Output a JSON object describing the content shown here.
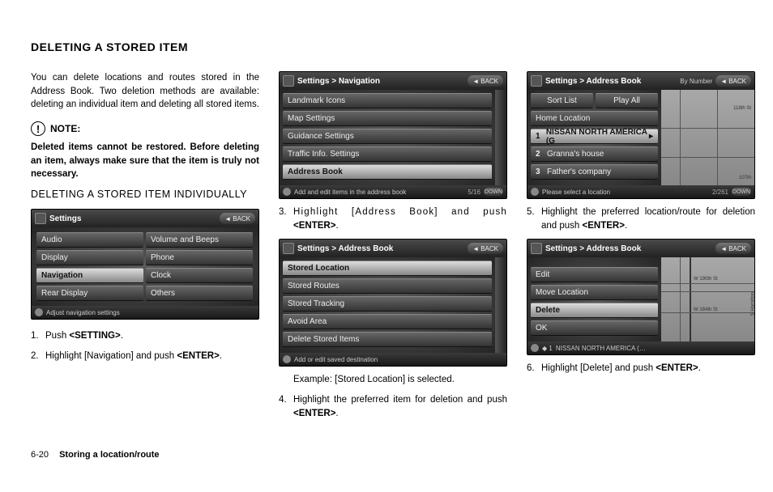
{
  "page": {
    "title": "DELETING A STORED ITEM",
    "intro": "You can delete locations and routes stored in the Address Book. Two deletion methods are available: deleting an individual item and deleting all stored items.",
    "note_label": "NOTE:",
    "note_text": "Deleted items cannot be restored. Before deleting an item, always make sure that the item is truly not necessary.",
    "subhead": "DELETING A STORED ITEM INDIVIDUALLY",
    "footer_page": "6-20",
    "footer_section": "Storing a location/route"
  },
  "steps": {
    "s1": "Push <SETTING>.",
    "s2": "Highlight [Navigation] and push <ENTER>.",
    "s3": "Highlight [Address Book] and push <ENTER>.",
    "s3_ex": "Example: [Stored Location] is selected.",
    "s4": "Highlight the preferred item for deletion and push <ENTER>.",
    "s5": "Highlight the preferred location/route for deletion and push <ENTER>.",
    "s6": "Highlight [Delete] and push <ENTER>."
  },
  "ui": {
    "back": "BACK",
    "scr1": {
      "title": "Settings",
      "foot": "Adjust navigation settings",
      "items_l": [
        "Audio",
        "Display",
        "Navigation",
        "Rear Display"
      ],
      "items_r": [
        "Volume and Beeps",
        "Phone",
        "Clock",
        "Others"
      ],
      "sel": 2
    },
    "scr2": {
      "title": "Settings > Navigation",
      "foot": "Add and edit items in the address book",
      "items": [
        "Landmark Icons",
        "Map Settings",
        "Guidance Settings",
        "Traffic Info. Settings",
        "Address Book"
      ],
      "sel": 4,
      "scroll_text": "5/16",
      "scroll_btn": "DOWN"
    },
    "scr3": {
      "title": "Settings > Address Book",
      "foot": "Add or edit saved destination",
      "items": [
        "Stored Location",
        "Stored Routes",
        "Stored Tracking",
        "Avoid Area",
        "Delete Stored Items"
      ],
      "sel": 0
    },
    "scr4": {
      "title": "Settings > Address Book",
      "foot": "Please select a location",
      "top_right": "By Number",
      "btn_sort": "Sort List",
      "btn_play": "Play All",
      "items": [
        {
          "n": "",
          "t": "Home Location"
        },
        {
          "n": "1",
          "t": "NISSAN NORTH AMERICA (G"
        },
        {
          "n": "2",
          "t": "Granna's house"
        },
        {
          "n": "3",
          "t": "Father's company"
        }
      ],
      "sel": 1,
      "scroll_text": "2/261",
      "scroll_btn": "DOWN",
      "map_labels": [
        "118th St",
        "107th"
      ]
    },
    "scr5": {
      "title": "Settings > Address Book",
      "foot": "NISSAN NORTH AMERICA (…",
      "items": [
        "Edit",
        "Move Location",
        "Delete",
        "OK"
      ],
      "sel": 2,
      "map_labels": [
        "W 190th St",
        "W 184th St",
        "S Hamilton"
      ]
    }
  }
}
